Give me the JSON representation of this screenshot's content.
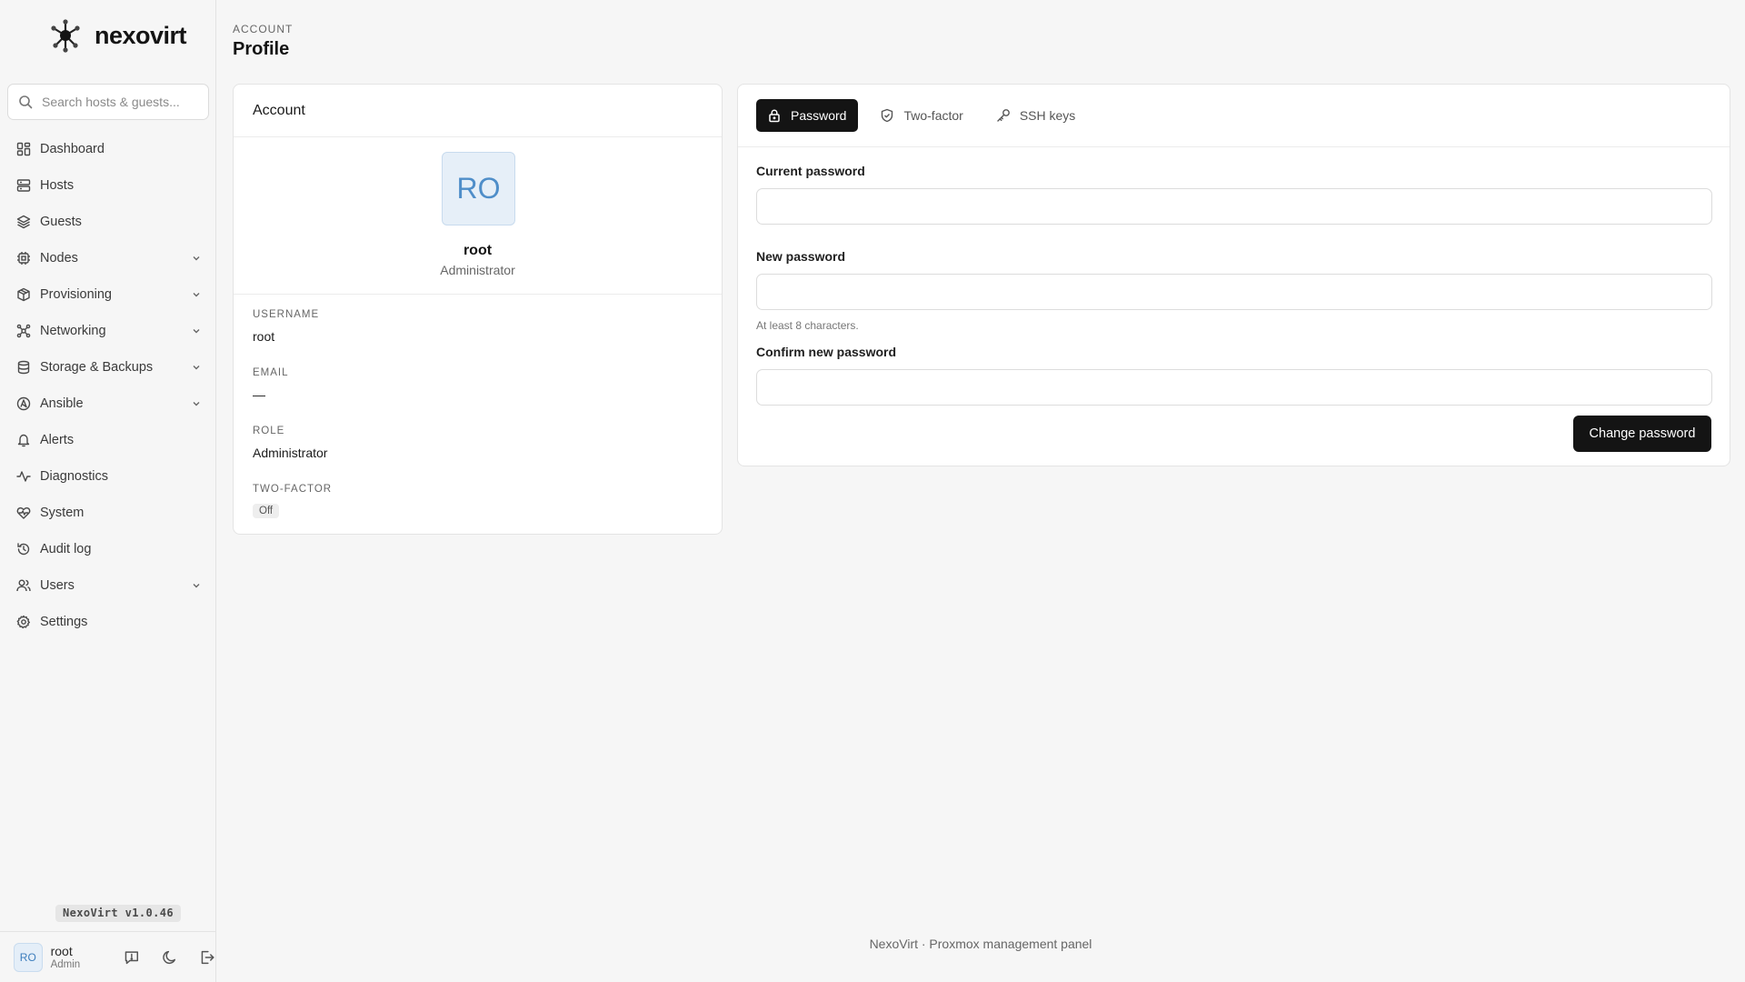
{
  "brand": {
    "name": "nexovirt"
  },
  "search": {
    "placeholder": "Search hosts & guests..."
  },
  "nav": [
    {
      "label": "Dashboard",
      "icon": "dashboard-icon",
      "expandable": false
    },
    {
      "label": "Hosts",
      "icon": "server-icon",
      "expandable": false
    },
    {
      "label": "Guests",
      "icon": "layers-icon",
      "expandable": false
    },
    {
      "label": "Nodes",
      "icon": "cpu-icon",
      "expandable": true
    },
    {
      "label": "Provisioning",
      "icon": "package-icon",
      "expandable": true
    },
    {
      "label": "Networking",
      "icon": "network-icon",
      "expandable": true
    },
    {
      "label": "Storage & Backups",
      "icon": "database-icon",
      "expandable": true
    },
    {
      "label": "Ansible",
      "icon": "ansible-icon",
      "expandable": true
    },
    {
      "label": "Alerts",
      "icon": "bell-icon",
      "expandable": false
    },
    {
      "label": "Diagnostics",
      "icon": "activity-icon",
      "expandable": false
    },
    {
      "label": "System",
      "icon": "heart-pulse-icon",
      "expandable": false
    },
    {
      "label": "Audit log",
      "icon": "history-icon",
      "expandable": false
    },
    {
      "label": "Users",
      "icon": "users-icon",
      "expandable": true
    },
    {
      "label": "Settings",
      "icon": "gear-icon",
      "expandable": false
    }
  ],
  "version": "NexoVirt v1.0.46",
  "user": {
    "initials": "RO",
    "name": "root",
    "role": "Admin"
  },
  "header": {
    "breadcrumb": "ACCOUNT",
    "title": "Profile"
  },
  "account": {
    "heading": "Account",
    "avatar_initials": "RO",
    "name": "root",
    "role": "Administrator",
    "fields": {
      "username_label": "USERNAME",
      "username": "root",
      "email_label": "EMAIL",
      "email": "—",
      "role_label": "ROLE",
      "role": "Administrator",
      "twofactor_label": "TWO-FACTOR",
      "twofactor": "Off"
    }
  },
  "security": {
    "tabs": {
      "password": "Password",
      "twofactor": "Two-factor",
      "ssh": "SSH keys"
    },
    "current_label": "Current password",
    "current_value": "",
    "new_label": "New password",
    "new_value": "",
    "new_hint": "At least 8 characters.",
    "confirm_label": "Confirm new password",
    "confirm_value": "",
    "submit": "Change password"
  },
  "footer": "NexoVirt · Proxmox management panel",
  "colors": {
    "accent": "#141414",
    "avatar_bg": "#e6eff8",
    "avatar_text": "#4f8ec9",
    "page_bg": "#f6f6f6"
  }
}
